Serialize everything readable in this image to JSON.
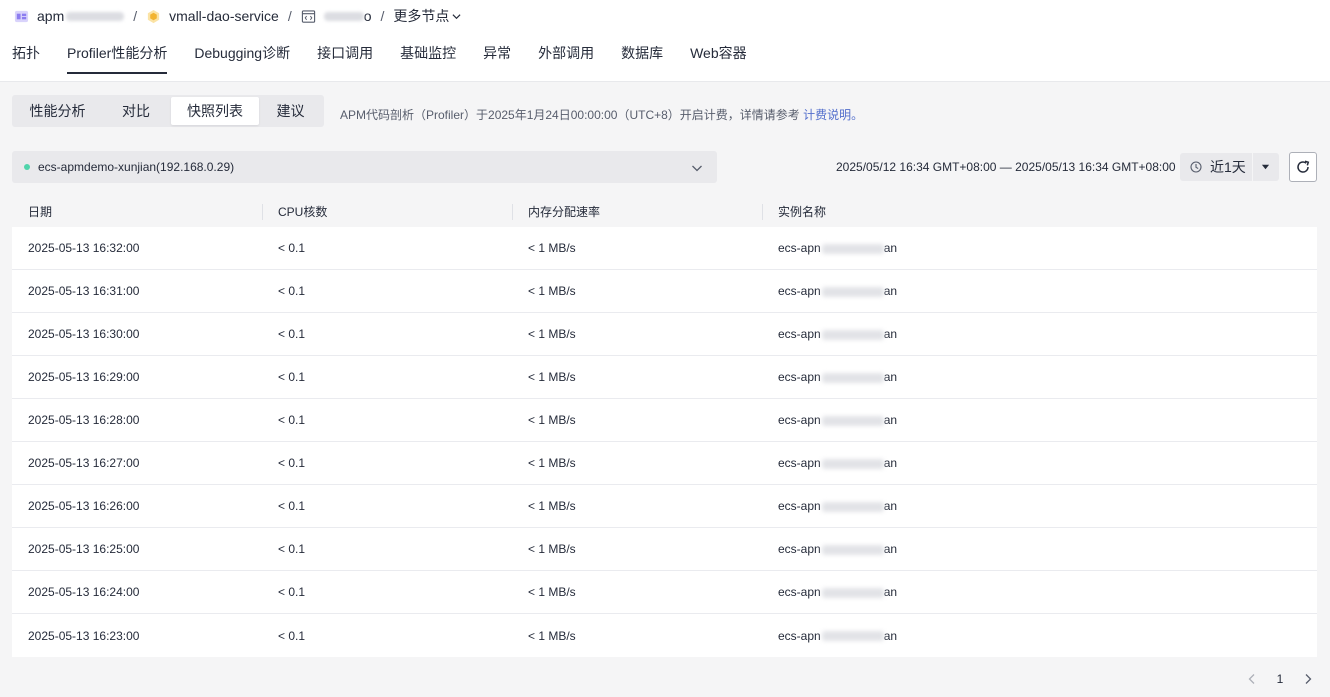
{
  "breadcrumb": {
    "app_prefix": "apm",
    "service": "vmall-dao-service",
    "node_suffix": "o",
    "more": "更多节点",
    "separator": "/"
  },
  "top_tabs": [
    "拓扑",
    "Profiler性能分析",
    "Debugging诊断",
    "接口调用",
    "基础监控",
    "异常",
    "外部调用",
    "数据库",
    "Web容器"
  ],
  "top_tab_active": "Profiler性能分析",
  "sub_tabs": [
    "性能分析",
    "对比",
    "快照列表",
    "建议"
  ],
  "sub_tab_active": "快照列表",
  "notice": {
    "text": "APM代码剖析（Profiler）于2025年1月24日00:00:00（UTC+8）开启计费，详情请参考",
    "link": "计费说明。"
  },
  "instance_select": {
    "value": "ecs-apmdemo-xunjian(192.168.0.29)",
    "status_color": "#50d4ab"
  },
  "time_range": {
    "text": "2025/05/12 16:34 GMT+08:00 — 2025/05/13 16:34 GMT+08:00",
    "picker_label": "近1天"
  },
  "table": {
    "headers": [
      "日期",
      "CPU核数",
      "内存分配速率",
      "实例名称"
    ],
    "rows": [
      {
        "date": "2025-05-13 16:32:00",
        "cpu": "< 0.1",
        "mem": "< 1 MB/s",
        "inst_prefix": "ecs-apn",
        "inst_suffix": "an"
      },
      {
        "date": "2025-05-13 16:31:00",
        "cpu": "< 0.1",
        "mem": "< 1 MB/s",
        "inst_prefix": "ecs-apn",
        "inst_suffix": "an"
      },
      {
        "date": "2025-05-13 16:30:00",
        "cpu": "< 0.1",
        "mem": "< 1 MB/s",
        "inst_prefix": "ecs-apn",
        "inst_suffix": "an"
      },
      {
        "date": "2025-05-13 16:29:00",
        "cpu": "< 0.1",
        "mem": "< 1 MB/s",
        "inst_prefix": "ecs-apn",
        "inst_suffix": "an"
      },
      {
        "date": "2025-05-13 16:28:00",
        "cpu": "< 0.1",
        "mem": "< 1 MB/s",
        "inst_prefix": "ecs-apn",
        "inst_suffix": "an"
      },
      {
        "date": "2025-05-13 16:27:00",
        "cpu": "< 0.1",
        "mem": "< 1 MB/s",
        "inst_prefix": "ecs-apn",
        "inst_suffix": "an"
      },
      {
        "date": "2025-05-13 16:26:00",
        "cpu": "< 0.1",
        "mem": "< 1 MB/s",
        "inst_prefix": "ecs-apn",
        "inst_suffix": "an"
      },
      {
        "date": "2025-05-13 16:25:00",
        "cpu": "< 0.1",
        "mem": "< 1 MB/s",
        "inst_prefix": "ecs-apn",
        "inst_suffix": "an"
      },
      {
        "date": "2025-05-13 16:24:00",
        "cpu": "< 0.1",
        "mem": "< 1 MB/s",
        "inst_prefix": "ecs-apn",
        "inst_suffix": "an"
      },
      {
        "date": "2025-05-13 16:23:00",
        "cpu": "< 0.1",
        "mem": "< 1 MB/s",
        "inst_prefix": "ecs-apn",
        "inst_suffix": "an"
      }
    ]
  },
  "pagination": {
    "current_page": "1"
  },
  "icons": {
    "app": "app-grid-icon",
    "service": "hexagon-icon",
    "node": "code-window-icon",
    "dropdown": "chevron-down-icon",
    "time": "clock-icon",
    "caret": "caret-down-icon",
    "refresh": "refresh-icon",
    "prev": "chevron-left-icon",
    "next": "chevron-right-icon"
  },
  "colors": {
    "accent_link": "#526ecc",
    "status_dot": "#50d4ab",
    "app_icon": "#8c7df0",
    "service_icon": "#f2b431"
  }
}
